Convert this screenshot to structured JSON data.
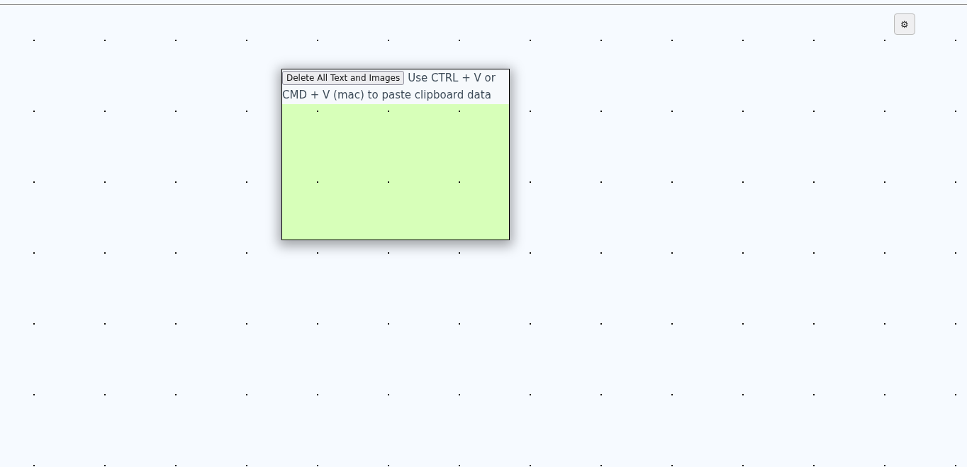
{
  "settings_button": {
    "label": "⚙"
  },
  "paste_panel": {
    "delete_button": {
      "label": "Delete All Text and Images"
    },
    "instruction_lines": [
      "Use CTRL + V or",
      "CMD + V (mac) to paste clipboard data"
    ]
  }
}
